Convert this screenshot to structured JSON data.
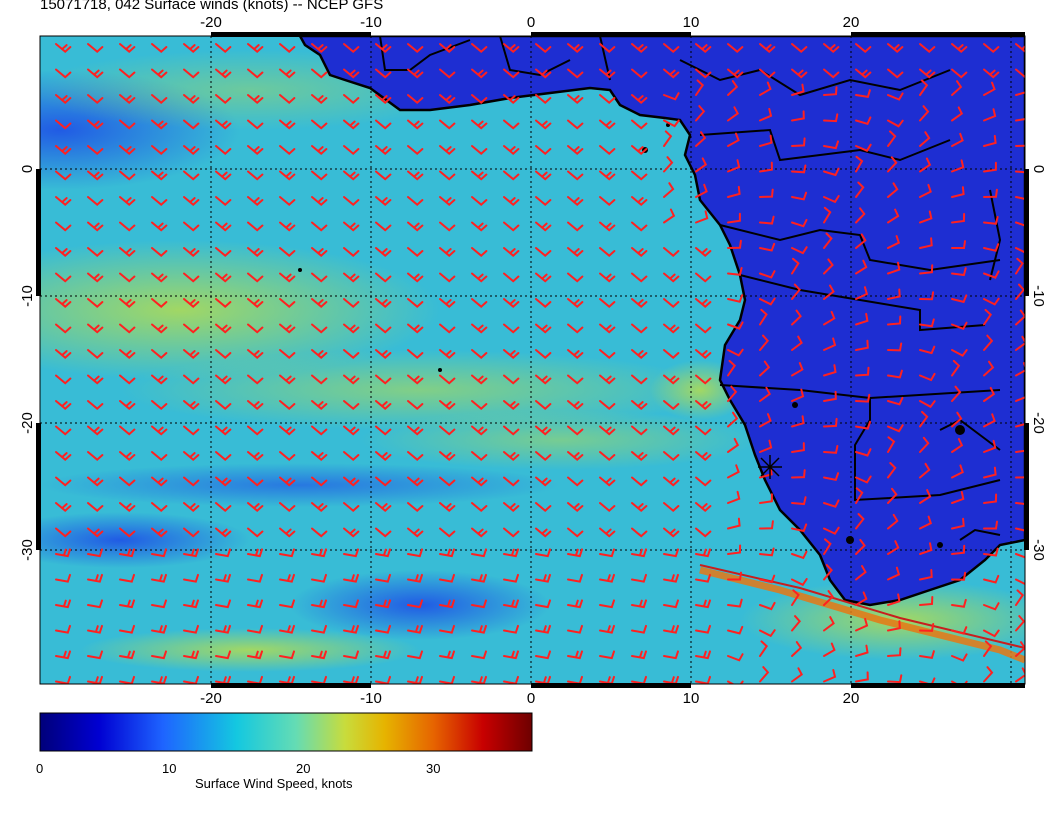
{
  "title": "15071718, 042 Surface winds (knots) -- NCEP GFS",
  "axes": {
    "lon_ticks": [
      "-20",
      "-10",
      "0",
      "10",
      "20"
    ],
    "lat_ticks": [
      "0",
      "-10",
      "-20",
      "-30"
    ]
  },
  "colorbar": {
    "label": "Surface Wind Speed, knots",
    "ticks": [
      "0",
      "10",
      "20",
      "30"
    ],
    "colors": [
      "#00007a",
      "#0000d2",
      "#1e64ff",
      "#14c8e0",
      "#64dcb4",
      "#c8dc3c",
      "#e6b400",
      "#e66400",
      "#c80000",
      "#6e0000"
    ]
  },
  "map": {
    "ocean_color": "#3cc8d8",
    "land_color": "#1e2ed2",
    "barb_color": "#ff2020",
    "coast_color": "#000000"
  }
}
